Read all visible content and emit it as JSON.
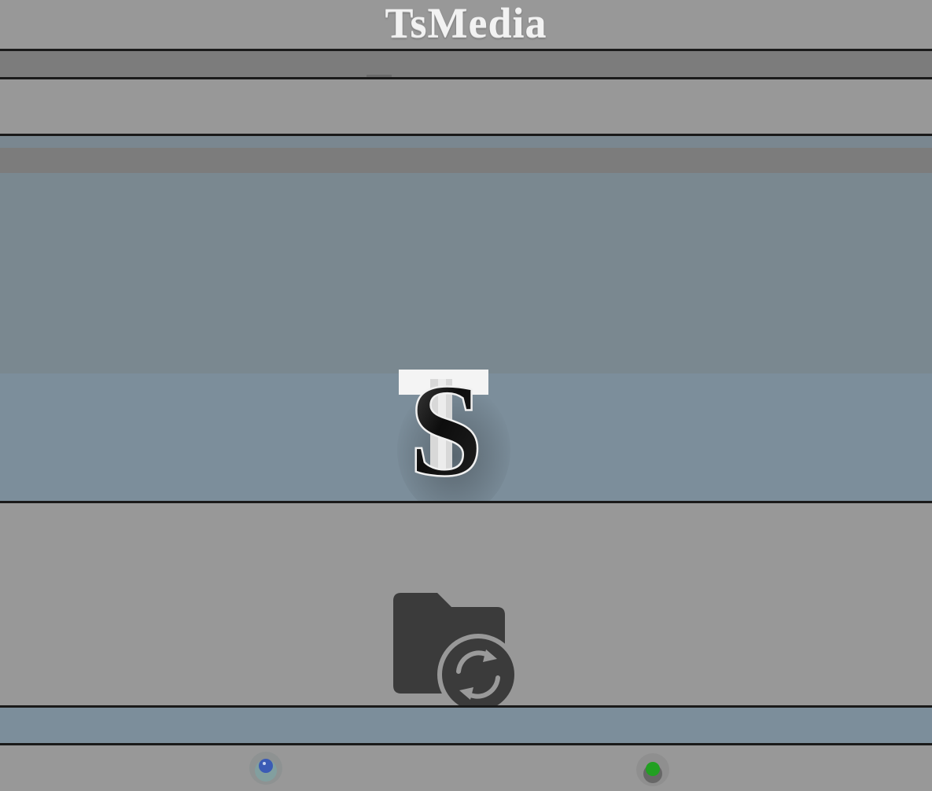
{
  "header": {
    "app_title": "TsMedia"
  },
  "logo": {
    "icon": "ts-logo-icon"
  },
  "main": {
    "action_icon": "folder-sync-icon"
  },
  "footer": {
    "indicators": [
      {
        "icon": "blue-dot-icon",
        "color": "#3b5bb5"
      },
      {
        "icon": "green-dot-icon",
        "color": "#22a022"
      }
    ]
  },
  "colors": {
    "background": "#989898",
    "band_blue": "#7c8e9b",
    "band_slate": "#7a8890",
    "divider": "#1a1a1a",
    "title_text": "#f2f2f2"
  }
}
